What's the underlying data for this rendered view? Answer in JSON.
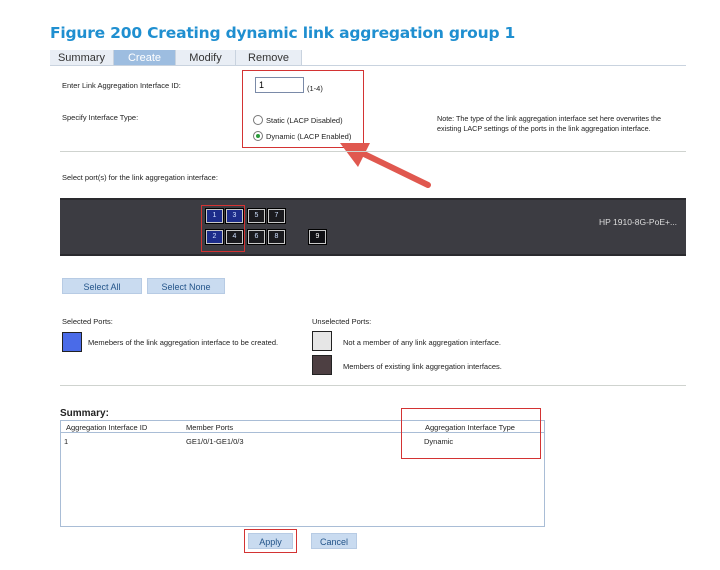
{
  "figure_title": "Figure 200 Creating dynamic link aggregation group 1",
  "tabs": [
    {
      "label": "Summary",
      "active": false
    },
    {
      "label": "Create",
      "active": true
    },
    {
      "label": "Modify",
      "active": false
    },
    {
      "label": "Remove",
      "active": false
    }
  ],
  "form": {
    "interface_id_label": "Enter Link Aggregation Interface ID:",
    "interface_id_value": "1",
    "interface_id_range": "(1-4)",
    "interface_type_label": "Specify Interface Type:",
    "static_option": "Static (LACP Disabled)",
    "dynamic_option": "Dynamic (LACP Enabled)",
    "note": "Note: The type of the link aggregation interface set here overwrites the existing LACP settings of the ports in the link aggregation interface."
  },
  "ports_section": {
    "label": "Select port(s) for the link aggregation interface:",
    "device_name": "HP 1910-8G-PoE+...",
    "ports": [
      "1",
      "2",
      "3",
      "4",
      "5",
      "6",
      "7",
      "8",
      "9"
    ]
  },
  "buttons": {
    "select_all": "Select All",
    "select_none": "Select None",
    "apply": "Apply",
    "cancel": "Cancel"
  },
  "legend": {
    "selected_title": "Selected Ports:",
    "selected_desc": "Memebers of the link aggregation interface to be created.",
    "unselected_title": "Unselected Ports:",
    "not_member_desc": "Not a member of any link aggregation interface.",
    "existing_member_desc": "Members of existing link aggregation interfaces.",
    "colors": {
      "selected": "#4a6be8",
      "not_member": "#e6e6e6",
      "existing_member": "#4d3f42"
    }
  },
  "summary": {
    "title": "Summary:",
    "columns": [
      "Aggregation Interface ID",
      "Member Ports",
      "Aggregation Interface Type"
    ],
    "rows": [
      [
        "1",
        "GE1/0/1-GE1/0/3",
        "Dynamic"
      ]
    ]
  },
  "colors": {
    "accent": "#1f8fd0",
    "highlight": "#d33333",
    "tab_active": "#9dbde0"
  }
}
